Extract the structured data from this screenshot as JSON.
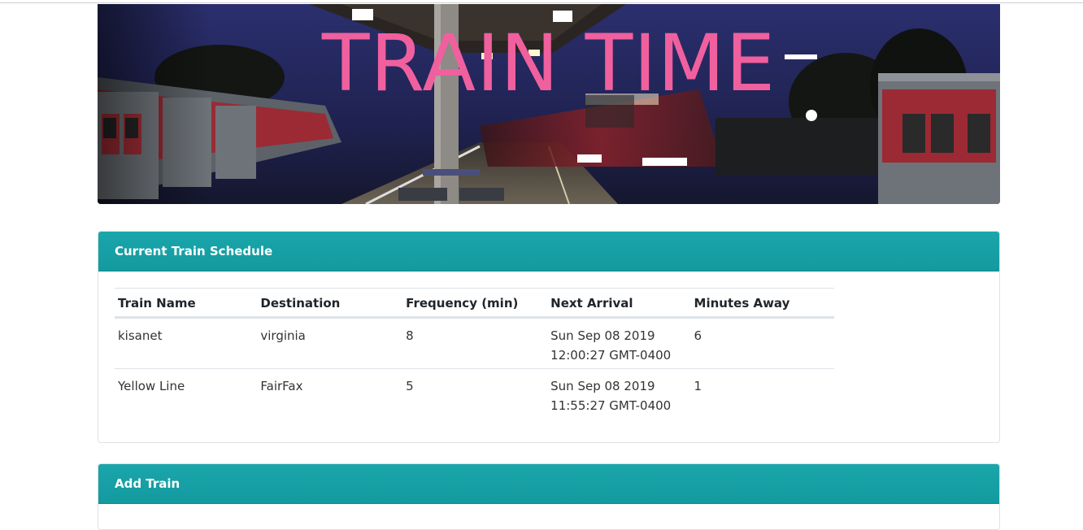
{
  "banner": {
    "title": "TRAIN TIME"
  },
  "schedule": {
    "header": "Current Train Schedule",
    "columns": [
      "Train Name",
      "Destination",
      "Frequency (min)",
      "Next Arrival",
      "Minutes Away"
    ],
    "rows": [
      {
        "name": "kisanet",
        "destination": "virginia",
        "frequency": "8",
        "next_arrival_date": "Sun Sep 08 2019",
        "next_arrival_time": "12:00:27 GMT-0400",
        "minutes_away": "6"
      },
      {
        "name": "Yellow Line",
        "destination": "FairFax",
        "frequency": "5",
        "next_arrival_date": "Sun Sep 08 2019",
        "next_arrival_time": "11:55:27 GMT-0400",
        "minutes_away": "1"
      }
    ]
  },
  "add_train": {
    "header": "Add Train"
  },
  "colors": {
    "header_bg": "#17a2a8",
    "title_pink": "#f0609e"
  }
}
